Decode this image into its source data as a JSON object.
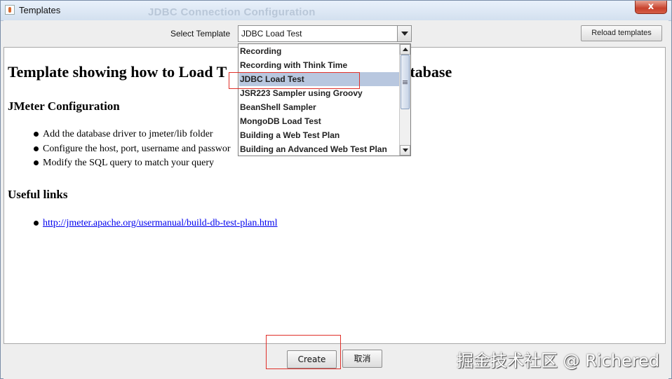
{
  "window": {
    "title": "Templates",
    "background_title": "JDBC Connection Configuration",
    "close_symbol": "x"
  },
  "toolbar": {
    "select_label": "Select Template",
    "selected_template": "JDBC Load Test",
    "reload_label": "Reload templates"
  },
  "dropdown": {
    "items": [
      "Recording",
      "Recording with Think Time",
      "JDBC Load Test",
      "JSR223 Sampler using Groovy",
      "BeanShell Sampler",
      "MongoDB Load Test",
      "Building a Web Test Plan",
      "Building an Advanced Web Test Plan"
    ],
    "selected_index": 2
  },
  "content": {
    "heading_left": "Template showing how to Load T",
    "heading_right": "atabase",
    "config_heading": "JMeter Configuration",
    "config_items": [
      "Add the database driver to jmeter/lib folder",
      "Configure the host, port, username and passwor",
      "Modify the SQL query to match your query"
    ],
    "links_heading": "Useful links",
    "link": "http://jmeter.apache.org/usermanual/build-db-test-plan.html"
  },
  "buttons": {
    "create": "Create",
    "cancel": "取消"
  },
  "watermark": "掘金技术社区 @ Richered",
  "colors": {
    "highlight_box": "#e0302a",
    "selected_item": "#b8c7df",
    "link": "#0000ee"
  }
}
